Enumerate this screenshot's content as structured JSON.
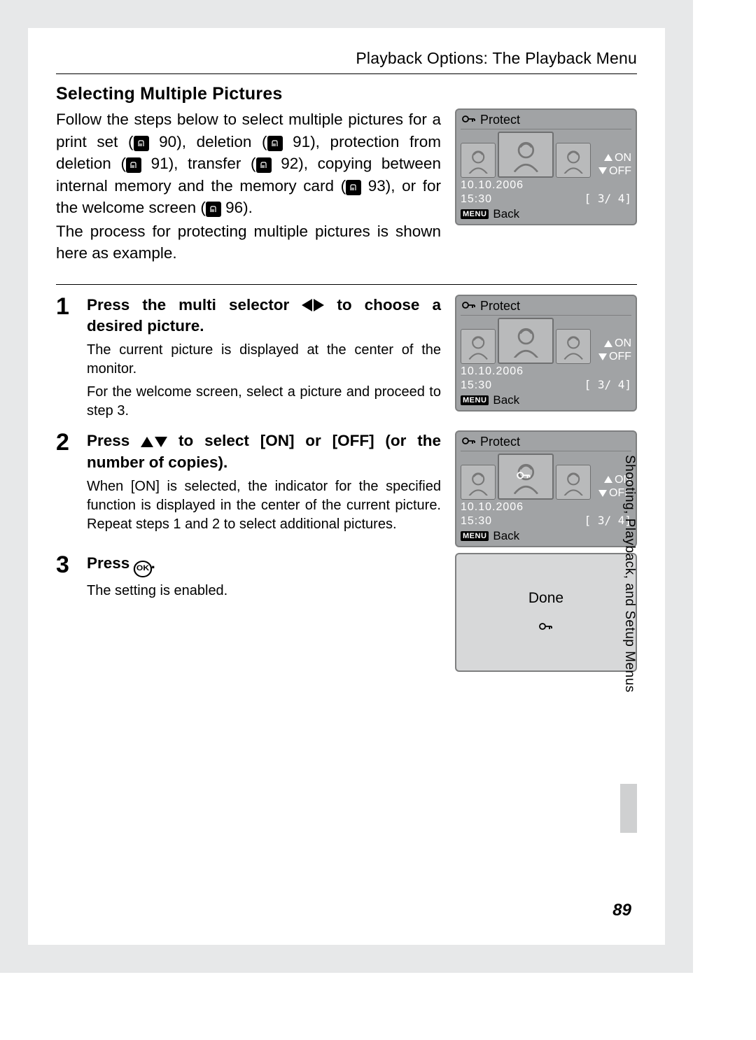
{
  "header": {
    "title": "Playback Options: The Playback Menu"
  },
  "section_title": "Selecting Multiple Pictures",
  "intro": {
    "p1a": "Follow the steps below to select multiple pictures for a print set (",
    "r1": "90",
    "p1b": "), deletion (",
    "r2": "91",
    "p1c": "), protection from deletion (",
    "r3": "91",
    "p1d": "), transfer (",
    "r4": "92",
    "p1e": "), copying between internal memory and the memory card (",
    "r5": "93",
    "p1f": "), or for the welcome screen (",
    "r6": "96",
    "p1g": ").",
    "p2": "The process for protecting multiple pictures is shown here as example."
  },
  "steps": [
    {
      "num": "1",
      "head_a": "Press the multi selector ",
      "head_b": " to choose a desired picture.",
      "desc": [
        "The current picture is displayed at the center of the monitor.",
        "For the welcome screen, select a picture and proceed to step 3."
      ]
    },
    {
      "num": "2",
      "head_a": "Press ",
      "head_b": " to select [ON] or [OFF] (or the number of copies).",
      "desc": [
        "When [ON] is selected, the indicator for the specified function is displayed in the center of the current picture. Repeat steps 1 and 2 to select additional pictures."
      ]
    },
    {
      "num": "3",
      "head_a": "Press ",
      "head_b": ".",
      "desc": [
        "The setting is enabled."
      ]
    }
  ],
  "lcd": {
    "title": "Protect",
    "on": "ON",
    "off": "OFF",
    "date": "10.10.2006",
    "time": "15:30",
    "count": "[   3/   4]",
    "menu": "MENU",
    "back": "Back"
  },
  "done": "Done",
  "side_label": "Shooting, Playback, and Setup Menus",
  "page_number": "89"
}
